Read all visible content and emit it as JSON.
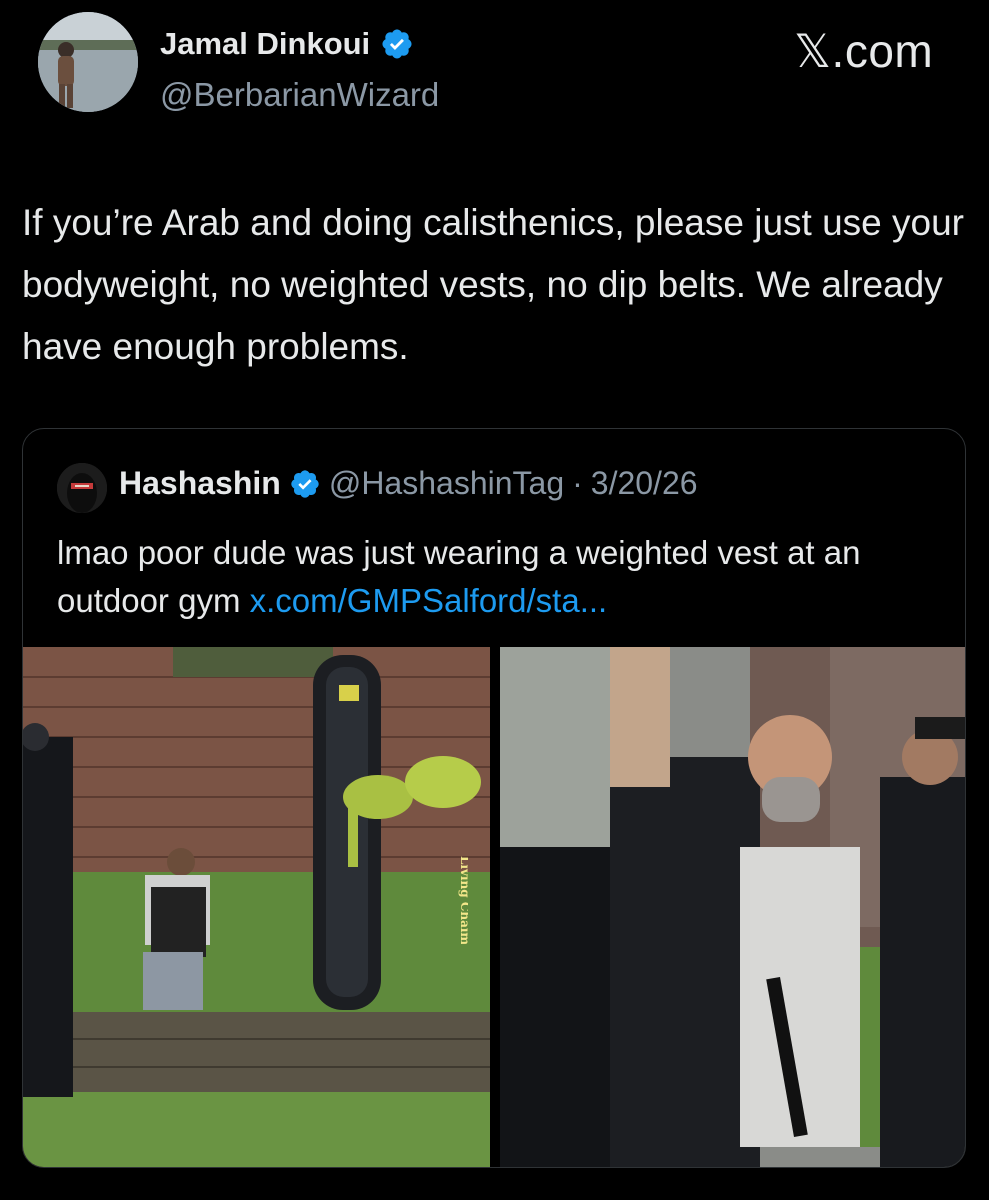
{
  "tweet": {
    "author_name": "Jamal Dinkoui",
    "author_handle": "@BerbarianWizard",
    "brand": "𝕏.com",
    "text": "If you’re Arab and doing calisthenics, please just use your bodyweight, no weighted vests, no dip belts. We already have enough problems."
  },
  "quote": {
    "author_name": "Hashashin",
    "author_handle": "@HashashinTag",
    "separator": "·",
    "date": "3/20/26",
    "text": "lmao poor dude was just wearing a weighted vest at an outdoor gym ",
    "link": "x.com/GMPSalford/sta..."
  },
  "media": {
    "watermark": "Living Chaim"
  },
  "colors": {
    "background": "#000000",
    "primary_text": "#e7e9ea",
    "secondary_text": "#8b98a5",
    "link": "#1d9bf0",
    "verified_badge": "#1d9bf0",
    "border": "#2f3336"
  },
  "icons": {
    "verified": "verified-badge-icon",
    "brand": "x-logo-icon"
  }
}
